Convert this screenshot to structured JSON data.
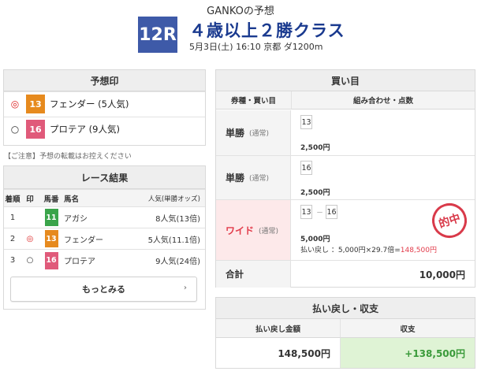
{
  "header": {
    "forecaster": "GANKOの予想",
    "race_number": "12R",
    "race_title": "４歳以上２勝クラス",
    "race_sub": "5月3日(土) 16:10 京都 ダ1200m"
  },
  "yosoin": {
    "title": "予想印",
    "picks": [
      {
        "mark": "◎",
        "number": "13",
        "color": "#e68a1e",
        "name": "フェンダー (5人気)"
      },
      {
        "mark": "○",
        "number": "16",
        "color": "#e05a7a",
        "name": "プロテア (9人気)"
      }
    ],
    "notice": "【ご注意】予想の転載はお控えください"
  },
  "results": {
    "title": "レース結果",
    "headers": {
      "pos": "着順",
      "mark": "印",
      "num": "馬番",
      "name": "馬名",
      "pop": "人気(単勝オッズ)"
    },
    "rows": [
      {
        "pos": "1",
        "mark": "",
        "number": "11",
        "color": "#3aa44a",
        "name": "アガシ",
        "pop": "8人気(13倍)"
      },
      {
        "pos": "2",
        "mark": "◎",
        "number": "13",
        "color": "#e68a1e",
        "name": "フェンダー",
        "pop": "5人気(11.1倍)"
      },
      {
        "pos": "3",
        "mark": "○",
        "number": "16",
        "color": "#e05a7a",
        "name": "プロテア",
        "pop": "9人気(24倍)"
      }
    ],
    "more_label": "もっとみる",
    "more_icon": "chevron-right-icon"
  },
  "kaime": {
    "title": "買い目",
    "col_type": "券種・買い目",
    "col_combo": "組み合わせ・点数",
    "rows": [
      {
        "type": "単勝",
        "sub": "(通常)",
        "combo": [
          "13"
        ],
        "amount": "2,500円"
      },
      {
        "type": "単勝",
        "sub": "(通常)",
        "combo": [
          "16"
        ],
        "amount": "2,500円"
      },
      {
        "type": "ワイド",
        "sub": "(通常)",
        "combo": [
          "13",
          "16"
        ],
        "separator": "－",
        "amount": "5,000円",
        "payout_prefix": "払い戻し ：5,000円×29.7倍=",
        "payout_value": "148,500円",
        "stamp": "的中"
      }
    ],
    "total_label": "合計",
    "total_value": "10,000円"
  },
  "payback": {
    "title": "払い戻し・収支",
    "col_payout": "払い戻し金額",
    "col_balance": "収支",
    "payout_value": "148,500円",
    "balance_value": "+138,500円"
  },
  "colors": {
    "badge": "#3e5aa8",
    "title": "#1a3a8f",
    "hit": "#e23c4b",
    "balance_bg": "#dff3d5",
    "balance_text": "#3a9a3a"
  }
}
